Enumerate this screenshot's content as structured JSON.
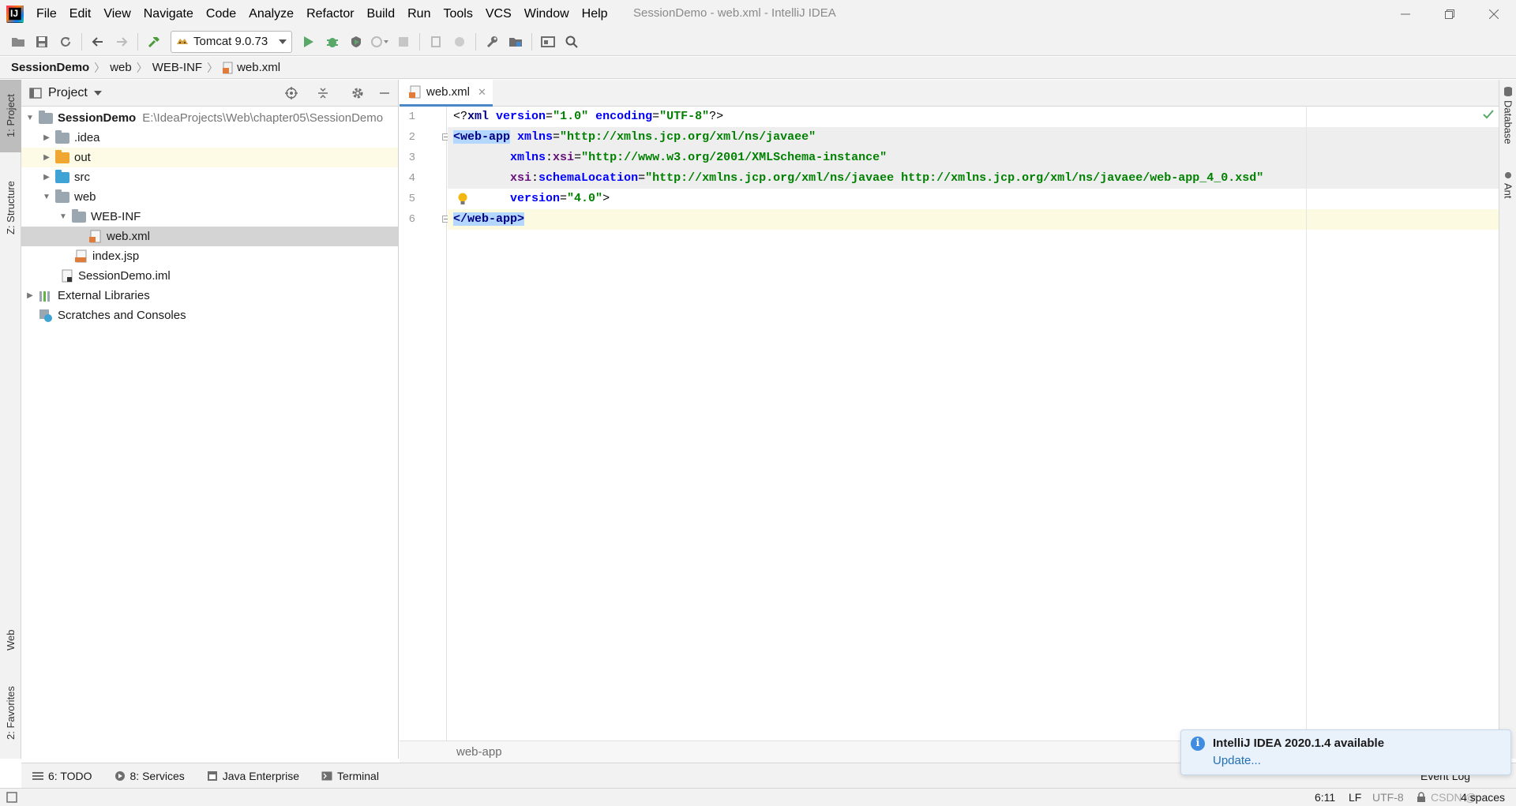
{
  "window": {
    "title": "SessionDemo - web.xml - IntelliJ IDEA"
  },
  "menu": [
    "File",
    "Edit",
    "View",
    "Navigate",
    "Code",
    "Analyze",
    "Refactor",
    "Build",
    "Run",
    "Tools",
    "VCS",
    "Window",
    "Help"
  ],
  "toolbar": {
    "run_config": "Tomcat 9.0.73"
  },
  "breadcrumb": [
    "SessionDemo",
    "web",
    "WEB-INF",
    "web.xml"
  ],
  "left_stripe": {
    "project_tab": "1: Project",
    "structure_tab": "Z: Structure",
    "web_tab": "Web",
    "favorites_tab": "2: Favorites"
  },
  "project": {
    "header": "Project",
    "tree": [
      {
        "label": "SessionDemo",
        "hint": "E:\\IdeaProjects\\Web\\chapter05\\SessionDemo"
      },
      {
        "label": ".idea"
      },
      {
        "label": "out"
      },
      {
        "label": "src"
      },
      {
        "label": "web"
      },
      {
        "label": "WEB-INF"
      },
      {
        "label": "web.xml"
      },
      {
        "label": "index.jsp"
      },
      {
        "label": "SessionDemo.iml"
      },
      {
        "label": "External Libraries"
      },
      {
        "label": "Scratches and Consoles"
      }
    ]
  },
  "editor": {
    "tab": "web.xml",
    "line_numbers": [
      "1",
      "2",
      "3",
      "4",
      "5",
      "6"
    ],
    "code": {
      "l1": {
        "a": "<?",
        "b": "xml",
        "c": " version",
        "d": "=",
        "e": "\"1.0\"",
        "f": " encoding",
        "g": "=",
        "h": "\"UTF-8\"",
        "i": "?>"
      },
      "l2": {
        "tag": "<web-app",
        "attr": " xmlns",
        "eq": "=",
        "val": "\"http://xmlns.jcp.org/xml/ns/javaee\""
      },
      "l3": {
        "indent": "        ",
        "ns": "xmlns",
        "colon": ":",
        "attr": "xsi",
        "eq": "=",
        "val": "\"http://www.w3.org/2001/XMLSchema-instance\""
      },
      "l4": {
        "indent": "        ",
        "ns": "xsi",
        "colon": ":",
        "attr": "schemaLocation",
        "eq": "=",
        "val": "\"http://xmlns.jcp.org/xml/ns/javaee http://xmlns.jcp.org/xml/ns/javaee/web-app_4_0.xsd\""
      },
      "l5": {
        "indent": "        ",
        "attr": "version",
        "eq": "=",
        "val": "\"4.0\"",
        "close": ">"
      },
      "l6": {
        "tag": "</web-app>"
      }
    },
    "bottom_breadcrumb": "web-app"
  },
  "right_stripe": {
    "database": "Database",
    "ant": "Ant"
  },
  "bottom_tabs": [
    "6: TODO",
    "8: Services",
    "Java Enterprise",
    "Terminal"
  ],
  "event_log": "Event Log",
  "status": {
    "position": "6:11",
    "line_sep": "LF",
    "encoding": "UTF-8",
    "indent": "4 spaces",
    "watermark": "CSDN @"
  },
  "notification": {
    "title": "IntelliJ IDEA 2020.1.4 available",
    "link": "Update..."
  },
  "colors": {
    "accent": "#4a88c7",
    "selection": "#b3d7ff",
    "tag": "#000080",
    "attribute": "#0000ff",
    "value": "#008000"
  }
}
